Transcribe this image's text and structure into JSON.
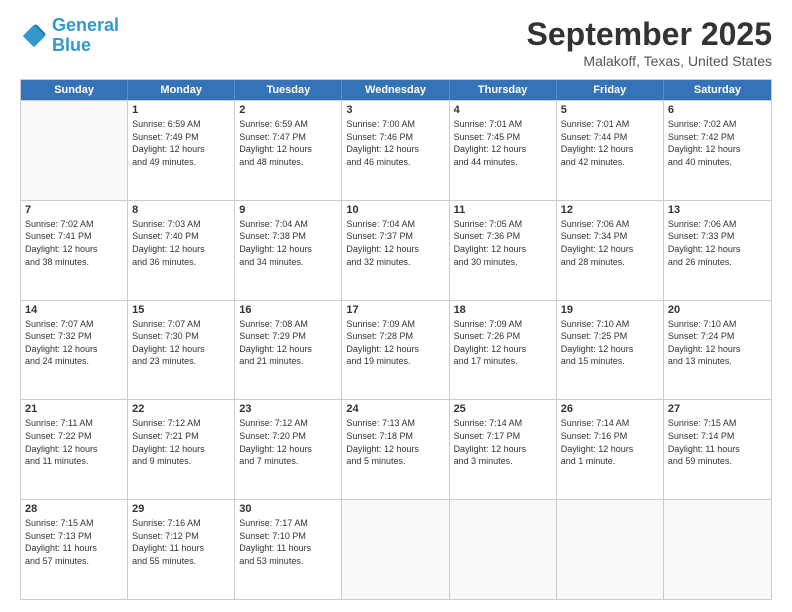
{
  "header": {
    "logo_line1": "General",
    "logo_line2": "Blue",
    "main_title": "September 2025",
    "subtitle": "Malakoff, Texas, United States"
  },
  "calendar": {
    "days_of_week": [
      "Sunday",
      "Monday",
      "Tuesday",
      "Wednesday",
      "Thursday",
      "Friday",
      "Saturday"
    ],
    "weeks": [
      [
        {
          "day": "",
          "info": ""
        },
        {
          "day": "1",
          "info": "Sunrise: 6:59 AM\nSunset: 7:49 PM\nDaylight: 12 hours\nand 49 minutes."
        },
        {
          "day": "2",
          "info": "Sunrise: 6:59 AM\nSunset: 7:47 PM\nDaylight: 12 hours\nand 48 minutes."
        },
        {
          "day": "3",
          "info": "Sunrise: 7:00 AM\nSunset: 7:46 PM\nDaylight: 12 hours\nand 46 minutes."
        },
        {
          "day": "4",
          "info": "Sunrise: 7:01 AM\nSunset: 7:45 PM\nDaylight: 12 hours\nand 44 minutes."
        },
        {
          "day": "5",
          "info": "Sunrise: 7:01 AM\nSunset: 7:44 PM\nDaylight: 12 hours\nand 42 minutes."
        },
        {
          "day": "6",
          "info": "Sunrise: 7:02 AM\nSunset: 7:42 PM\nDaylight: 12 hours\nand 40 minutes."
        }
      ],
      [
        {
          "day": "7",
          "info": "Sunrise: 7:02 AM\nSunset: 7:41 PM\nDaylight: 12 hours\nand 38 minutes."
        },
        {
          "day": "8",
          "info": "Sunrise: 7:03 AM\nSunset: 7:40 PM\nDaylight: 12 hours\nand 36 minutes."
        },
        {
          "day": "9",
          "info": "Sunrise: 7:04 AM\nSunset: 7:38 PM\nDaylight: 12 hours\nand 34 minutes."
        },
        {
          "day": "10",
          "info": "Sunrise: 7:04 AM\nSunset: 7:37 PM\nDaylight: 12 hours\nand 32 minutes."
        },
        {
          "day": "11",
          "info": "Sunrise: 7:05 AM\nSunset: 7:36 PM\nDaylight: 12 hours\nand 30 minutes."
        },
        {
          "day": "12",
          "info": "Sunrise: 7:06 AM\nSunset: 7:34 PM\nDaylight: 12 hours\nand 28 minutes."
        },
        {
          "day": "13",
          "info": "Sunrise: 7:06 AM\nSunset: 7:33 PM\nDaylight: 12 hours\nand 26 minutes."
        }
      ],
      [
        {
          "day": "14",
          "info": "Sunrise: 7:07 AM\nSunset: 7:32 PM\nDaylight: 12 hours\nand 24 minutes."
        },
        {
          "day": "15",
          "info": "Sunrise: 7:07 AM\nSunset: 7:30 PM\nDaylight: 12 hours\nand 23 minutes."
        },
        {
          "day": "16",
          "info": "Sunrise: 7:08 AM\nSunset: 7:29 PM\nDaylight: 12 hours\nand 21 minutes."
        },
        {
          "day": "17",
          "info": "Sunrise: 7:09 AM\nSunset: 7:28 PM\nDaylight: 12 hours\nand 19 minutes."
        },
        {
          "day": "18",
          "info": "Sunrise: 7:09 AM\nSunset: 7:26 PM\nDaylight: 12 hours\nand 17 minutes."
        },
        {
          "day": "19",
          "info": "Sunrise: 7:10 AM\nSunset: 7:25 PM\nDaylight: 12 hours\nand 15 minutes."
        },
        {
          "day": "20",
          "info": "Sunrise: 7:10 AM\nSunset: 7:24 PM\nDaylight: 12 hours\nand 13 minutes."
        }
      ],
      [
        {
          "day": "21",
          "info": "Sunrise: 7:11 AM\nSunset: 7:22 PM\nDaylight: 12 hours\nand 11 minutes."
        },
        {
          "day": "22",
          "info": "Sunrise: 7:12 AM\nSunset: 7:21 PM\nDaylight: 12 hours\nand 9 minutes."
        },
        {
          "day": "23",
          "info": "Sunrise: 7:12 AM\nSunset: 7:20 PM\nDaylight: 12 hours\nand 7 minutes."
        },
        {
          "day": "24",
          "info": "Sunrise: 7:13 AM\nSunset: 7:18 PM\nDaylight: 12 hours\nand 5 minutes."
        },
        {
          "day": "25",
          "info": "Sunrise: 7:14 AM\nSunset: 7:17 PM\nDaylight: 12 hours\nand 3 minutes."
        },
        {
          "day": "26",
          "info": "Sunrise: 7:14 AM\nSunset: 7:16 PM\nDaylight: 12 hours\nand 1 minute."
        },
        {
          "day": "27",
          "info": "Sunrise: 7:15 AM\nSunset: 7:14 PM\nDaylight: 11 hours\nand 59 minutes."
        }
      ],
      [
        {
          "day": "28",
          "info": "Sunrise: 7:15 AM\nSunset: 7:13 PM\nDaylight: 11 hours\nand 57 minutes."
        },
        {
          "day": "29",
          "info": "Sunrise: 7:16 AM\nSunset: 7:12 PM\nDaylight: 11 hours\nand 55 minutes."
        },
        {
          "day": "30",
          "info": "Sunrise: 7:17 AM\nSunset: 7:10 PM\nDaylight: 11 hours\nand 53 minutes."
        },
        {
          "day": "",
          "info": ""
        },
        {
          "day": "",
          "info": ""
        },
        {
          "day": "",
          "info": ""
        },
        {
          "day": "",
          "info": ""
        }
      ]
    ]
  }
}
